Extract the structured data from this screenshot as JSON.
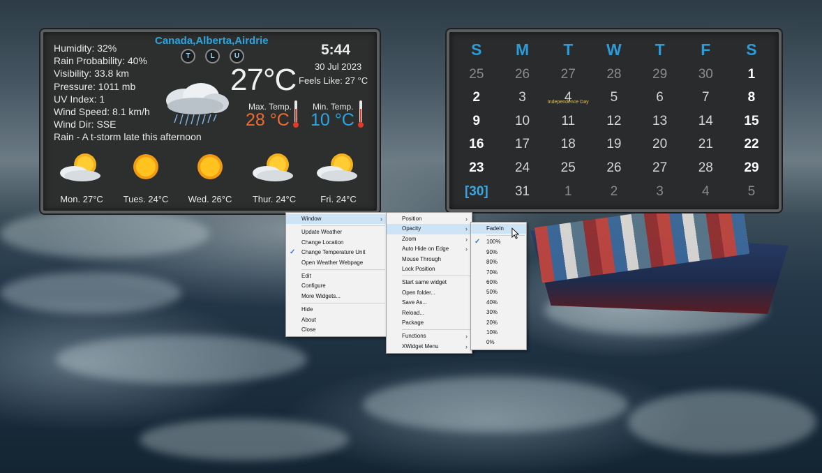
{
  "weather": {
    "location": "Canada,Alberta,Airdrie",
    "buttons": [
      "T",
      "L",
      "U"
    ],
    "details": [
      "Humidity: 32%",
      "Rain Probability: 40%",
      "Visibility: 33.8 km",
      "Pressure: 1011 mb",
      "UV Index: 1",
      "Wind Speed: 8.1 km/h",
      "Wind Dir: SSE",
      "Rain -  A t-storm late this afternoon"
    ],
    "time": "5:44",
    "date": "30 Jul 2023",
    "feels_like": "Feels Like: 27 °C",
    "current_temp": "27°C",
    "max_label": "Max. Temp.",
    "max_temp": "28 °C",
    "min_label": "Min. Temp.",
    "min_temp": "10 °C",
    "current_icon": "rain-cloud-icon",
    "forecast": [
      {
        "label": "Mon. 27°C",
        "icon": "partly-cloudy-icon"
      },
      {
        "label": "Tues. 24°C",
        "icon": "sunny-icon"
      },
      {
        "label": "Wed. 26°C",
        "icon": "sunny-icon"
      },
      {
        "label": "Thur. 24°C",
        "icon": "partly-cloudy-icon"
      },
      {
        "label": "Fri. 24°C",
        "icon": "partly-cloudy-icon"
      }
    ]
  },
  "calendar": {
    "headers": [
      "S",
      "M",
      "T",
      "W",
      "T",
      "F",
      "S"
    ],
    "weeks": [
      [
        "25",
        "26",
        "27",
        "28",
        "29",
        "30",
        "1"
      ],
      [
        "2",
        "3",
        "4",
        "5",
        "6",
        "7",
        "8"
      ],
      [
        "9",
        "10",
        "11",
        "12",
        "13",
        "14",
        "15"
      ],
      [
        "16",
        "17",
        "18",
        "19",
        "20",
        "21",
        "22"
      ],
      [
        "23",
        "24",
        "25",
        "26",
        "27",
        "28",
        "29"
      ],
      [
        "[30]",
        "31",
        "1",
        "2",
        "3",
        "4",
        "5"
      ]
    ],
    "event_text": "Independence Day",
    "colors": {
      "header": "#2d9bd6",
      "today": "#3aa7e3",
      "event": "#e8c54a"
    }
  },
  "menu_main": {
    "items": [
      {
        "label": "Window",
        "submenu": true,
        "selected": true
      },
      {
        "sep": true
      },
      {
        "label": "Update Weather"
      },
      {
        "label": "Change Location"
      },
      {
        "label": "Change Temperature Unit",
        "checked": true
      },
      {
        "label": "Open Weather Webpage"
      },
      {
        "sep": true
      },
      {
        "label": "Edit"
      },
      {
        "label": "Configure"
      },
      {
        "label": "More Widgets..."
      },
      {
        "sep": true
      },
      {
        "label": "Hide"
      },
      {
        "label": "About"
      },
      {
        "label": "Close"
      }
    ]
  },
  "menu_window": {
    "items": [
      {
        "label": "Position",
        "submenu": true
      },
      {
        "label": "Opacity",
        "submenu": true,
        "selected": true
      },
      {
        "label": "Zoom",
        "submenu": true
      },
      {
        "label": "Auto Hide on Edge",
        "submenu": true
      },
      {
        "label": "Mouse Through"
      },
      {
        "label": "Lock Position"
      },
      {
        "sep": true
      },
      {
        "label": "Start same widget"
      },
      {
        "label": "Open folder..."
      },
      {
        "label": "Save As..."
      },
      {
        "label": "Reload..."
      },
      {
        "label": "Package"
      },
      {
        "sep": true
      },
      {
        "label": "Functions",
        "submenu": true
      },
      {
        "label": "XWidget Menu",
        "submenu": true
      }
    ]
  },
  "menu_opacity": {
    "items": [
      {
        "label": "FadeIn",
        "selected": true
      },
      {
        "sep": true
      },
      {
        "label": "100%",
        "checked": true
      },
      {
        "label": "90%"
      },
      {
        "label": "80%"
      },
      {
        "label": "70%"
      },
      {
        "label": "60%"
      },
      {
        "label": "50%"
      },
      {
        "label": "40%"
      },
      {
        "label": "30%"
      },
      {
        "label": "20%"
      },
      {
        "label": "10%"
      },
      {
        "label": "0%"
      }
    ]
  }
}
